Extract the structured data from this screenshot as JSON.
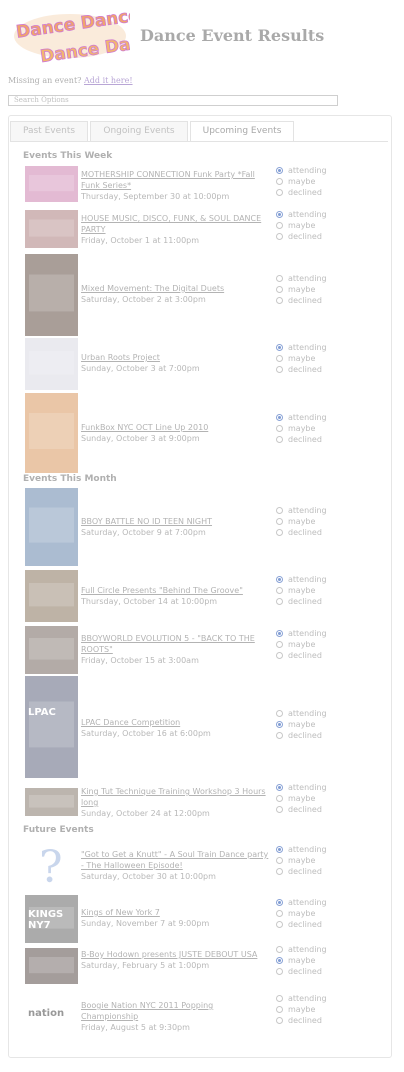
{
  "header": {
    "title": "Dance Event Results",
    "logo_text": "Dance Dance"
  },
  "missing": {
    "text": "Missing an event?",
    "link": "Add it here!"
  },
  "search": {
    "label": "Search Options"
  },
  "tabs": [
    "Past Events",
    "Ongoing Events",
    "Upcoming Events"
  ],
  "rsvp_labels": [
    "attending",
    "maybe",
    "declined"
  ],
  "sections": {
    "week": "Events This Week",
    "month": "Events This Month",
    "future": "Future Events"
  },
  "events": [
    {
      "title": "MOTHERSHIP CONNECTION Funk Party *Fall Funk Series*",
      "date": "Thursday, September 30 at 10:00pm",
      "rsvp": "attending",
      "thumb_color": "#d9a3c4"
    },
    {
      "title": "HOUSE MUSIC, DISCO, FUNK, & SOUL DANCE PARTY",
      "date": "Friday, October 1 at 11:00pm",
      "rsvp": "attending",
      "thumb_color": "#c2a0a0"
    },
    {
      "title": "Mixed Movement: The Digital Duets",
      "date": "Saturday, October 2 at 3:00pm",
      "rsvp": "none",
      "thumb_color": "#8c7d76"
    },
    {
      "title": "Urban Roots Project",
      "date": "Sunday, October 3 at 7:00pm",
      "rsvp": "attending",
      "thumb_color": "#e3e3ea"
    },
    {
      "title": "FunkBox NYC OCT Line Up 2010",
      "date": "Sunday, October 3 at 9:00pm",
      "rsvp": "attending",
      "thumb_color": "#e3b38a"
    },
    {
      "title": "BBOY BATTLE NO ID TEEN NIGHT",
      "date": "Saturday, October 9 at 7:00pm",
      "rsvp": "none",
      "thumb_color": "#8fa6c2"
    },
    {
      "title": "Full Circle Presents \"Behind The Groove\"",
      "date": "Thursday, October 14 at 10:00pm",
      "rsvp": "attending",
      "thumb_color": "#a89a88"
    },
    {
      "title": "BBOYWORLD EVOLUTION 5 - \"BACK TO THE ROOTS\"",
      "date": "Friday, October 15 at 3:00am",
      "rsvp": "attending",
      "thumb_color": "#9a8f8a"
    },
    {
      "title": "LPAC Dance Competition",
      "date": "Saturday, October 16 at 6:00pm",
      "rsvp": "maybe",
      "thumb_color": "#8a8ea0",
      "thumb_text": "LPAC"
    },
    {
      "title": "King Tut Technique Training Workshop 3 Hours long",
      "date": "Sunday, October 24 at 12:00pm",
      "rsvp": "attending",
      "thumb_color": "#a59c93"
    },
    {
      "title": "\"Got to Get a Knutt\" - A Soul Train Dance party - The Halloween Episode!",
      "date": "Saturday, October 30 at 10:00pm",
      "rsvp": "attending",
      "thumb_color": "#ffffff"
    },
    {
      "title": "Kings of New York 7",
      "date": "Sunday, November 7 at 9:00pm",
      "rsvp": "attending",
      "thumb_color": "#8f8f8f",
      "thumb_text": "KINGS NY7"
    },
    {
      "title": "B-Boy Hodown presents JUSTE DEBOUT USA",
      "date": "Saturday, February 5 at 1:00pm",
      "rsvp": "maybe",
      "thumb_color": "#857c7a"
    },
    {
      "title": "Boogie Nation NYC 2011 Popping Championship",
      "date": "Friday, August 5 at 9:30pm",
      "rsvp": "none",
      "thumb_color": "#ffffff",
      "thumb_text": "nation"
    }
  ]
}
